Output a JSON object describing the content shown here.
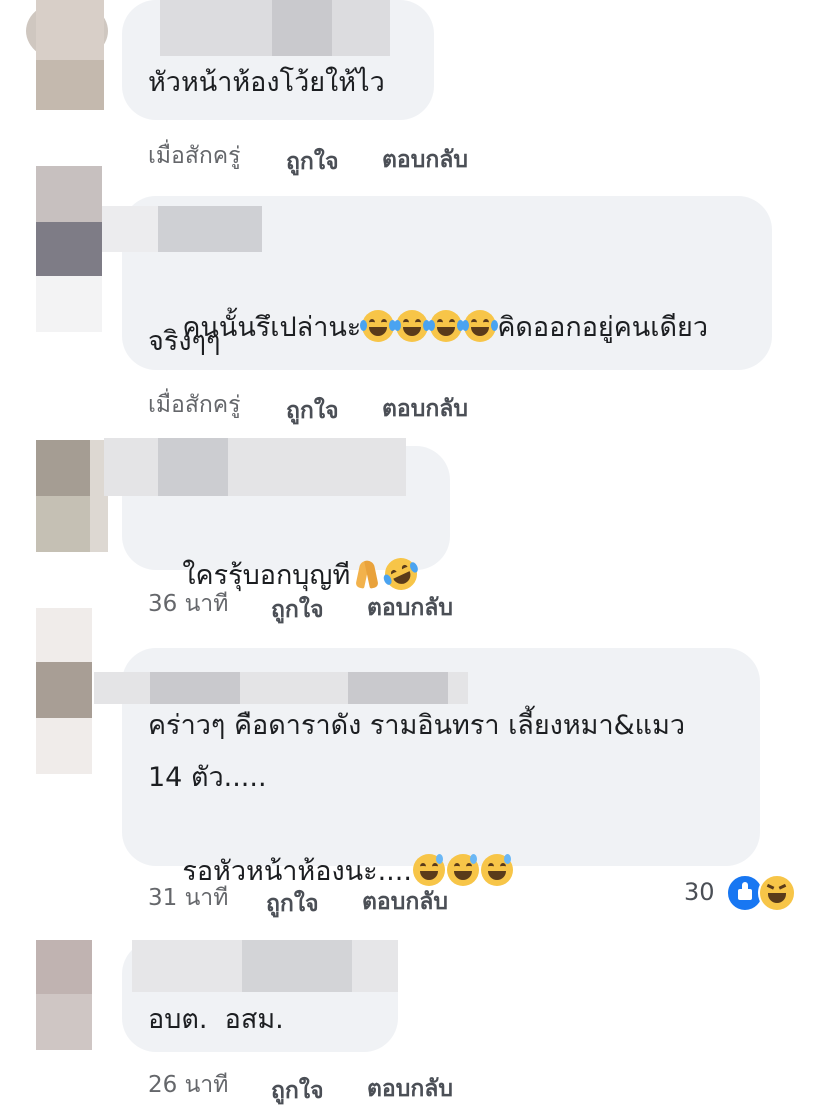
{
  "comments": [
    {
      "text": "หัวหน้าห้องโว้ยให้ไว",
      "time": "เมื่อสักครู่",
      "like": "ถูกใจ",
      "reply": "ตอบกลับ"
    },
    {
      "text_line1": "คนนั้นรึเปล่านะ",
      "text_line1_after": "คิดออกอยู่คนเดียว",
      "text_line2": "จริงๆๆ",
      "time": "เมื่อสักครู่",
      "like": "ถูกใจ",
      "reply": "ตอบกลับ"
    },
    {
      "text": "ใครรุ้บอกบุญที",
      "time": "36 นาที",
      "like": "ถูกใจ",
      "reply": "ตอบกลับ"
    },
    {
      "text_line1": "คร่าวๆ คือดาราดัง รามอินทรา เลี้ยงหมา&แมว",
      "text_line2": "14 ตัว.....",
      "text_line3": "รอหัวหน้าห้องนะ....",
      "time": "31 นาที",
      "like": "ถูกใจ",
      "reply": "ตอบกลับ",
      "reaction_count": "30"
    },
    {
      "text": "อบต.  อสม.",
      "time": "26 นาที",
      "like": "ถูกใจ",
      "reply": "ตอบกลับ"
    }
  ],
  "colors": {
    "bubble": "#f0f2f5",
    "like_blue": "#1877f2",
    "haha_yellow": "#f7c548"
  },
  "icons": [
    "laughing-tears-emoji",
    "praying-hands-emoji",
    "rofl-emoji",
    "grin-sweat-emoji",
    "like-reaction-icon",
    "haha-reaction-icon"
  ]
}
